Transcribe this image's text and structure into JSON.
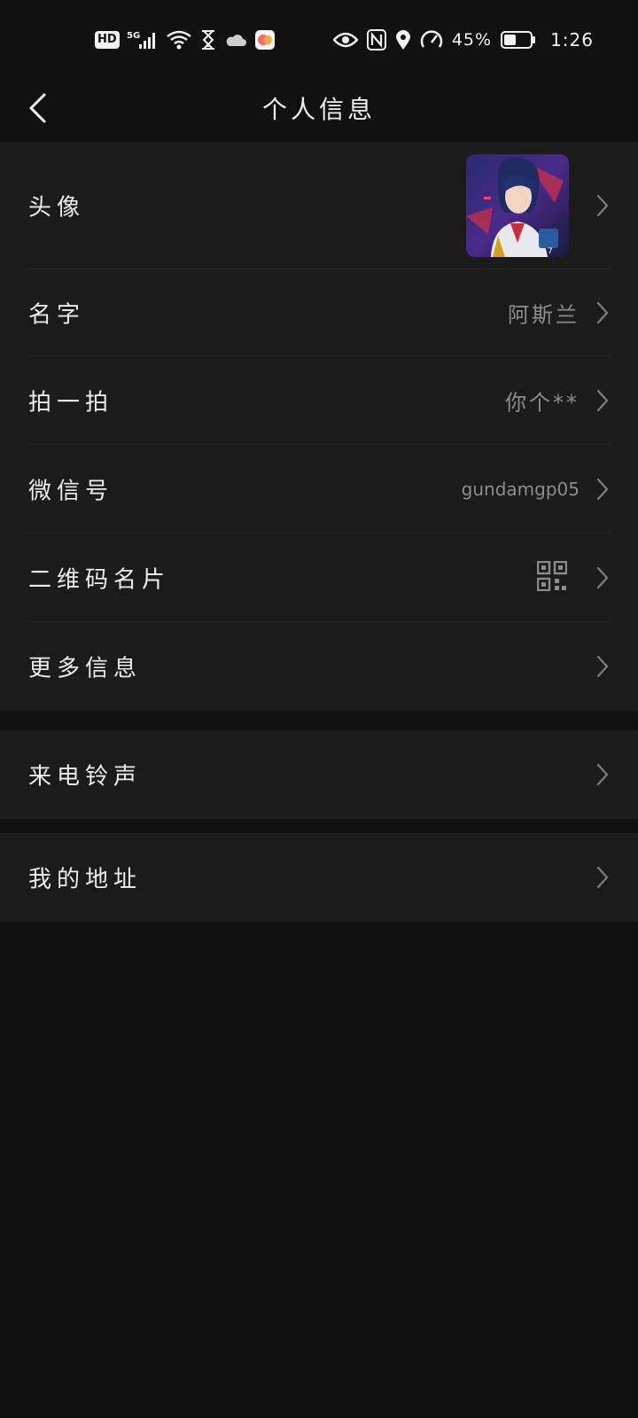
{
  "status_bar": {
    "hd": "HD",
    "net": "5G",
    "battery": "45%",
    "time": "1:26",
    "icons_left": [
      "hd-icon",
      "signal-5g-icon",
      "wifi-icon",
      "hourglass-icon",
      "cloud-icon",
      "app-notification-icon"
    ],
    "icons_right": [
      "eye-icon",
      "nfc-icon",
      "location-icon",
      "speed-icon",
      "battery-icon"
    ]
  },
  "header": {
    "title": "个人信息",
    "back_icon": "chevron-left-icon"
  },
  "rows": {
    "avatar": {
      "label": "头像"
    },
    "name": {
      "label": "名字",
      "value": "阿斯兰"
    },
    "pat": {
      "label": "拍一拍",
      "value": "你个**"
    },
    "wechat_id": {
      "label": "微信号",
      "value": "gundamgp05"
    },
    "qr_card": {
      "label": "二维码名片",
      "icon": "qr-code-icon"
    },
    "more_info": {
      "label": "更多信息"
    },
    "ringtone": {
      "label": "来电铃声"
    },
    "address": {
      "label": "我的地址"
    }
  },
  "colors": {
    "background": "#111111",
    "row_background": "#1b1b1b",
    "divider": "#262626",
    "value_text": "#8c8c8c",
    "chevron": "#7a7a7a"
  }
}
